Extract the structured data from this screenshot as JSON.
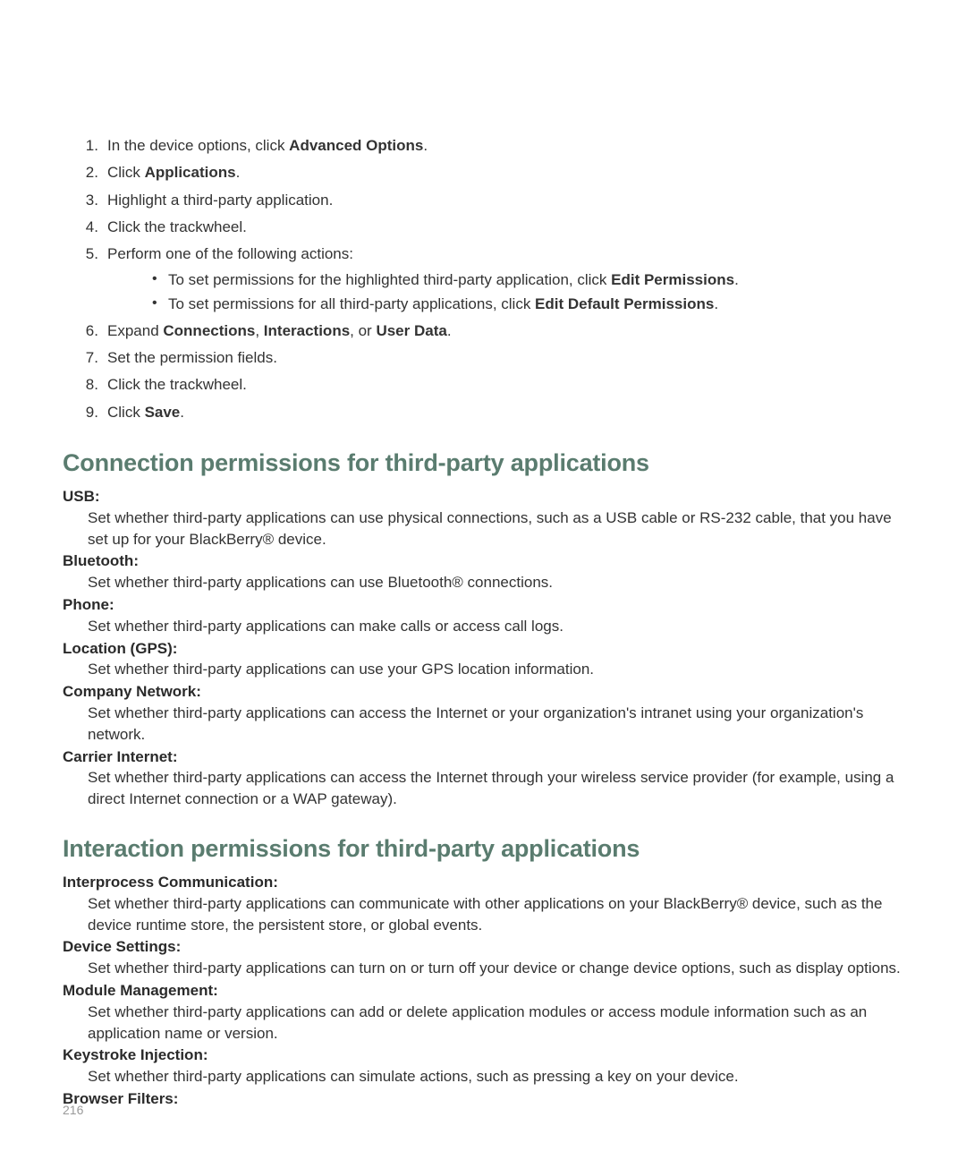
{
  "steps": [
    {
      "parts": [
        {
          "t": "In the device options, click "
        },
        {
          "t": "Advanced Options",
          "b": true
        },
        {
          "t": "."
        }
      ]
    },
    {
      "parts": [
        {
          "t": "Click "
        },
        {
          "t": "Applications",
          "b": true
        },
        {
          "t": "."
        }
      ]
    },
    {
      "parts": [
        {
          "t": "Highlight a third-party application."
        }
      ]
    },
    {
      "parts": [
        {
          "t": "Click the trackwheel."
        }
      ]
    },
    {
      "parts": [
        {
          "t": "Perform one of the following actions:"
        }
      ],
      "sub": [
        [
          {
            "t": "To set permissions for the highlighted third-party application, click "
          },
          {
            "t": "Edit Permissions",
            "b": true
          },
          {
            "t": "."
          }
        ],
        [
          {
            "t": "To set permissions for all third-party applications, click "
          },
          {
            "t": "Edit Default Permissions",
            "b": true
          },
          {
            "t": "."
          }
        ]
      ]
    },
    {
      "parts": [
        {
          "t": "Expand "
        },
        {
          "t": "Connections",
          "b": true
        },
        {
          "t": ", "
        },
        {
          "t": "Interactions",
          "b": true
        },
        {
          "t": ", or "
        },
        {
          "t": "User Data",
          "b": true
        },
        {
          "t": "."
        }
      ]
    },
    {
      "parts": [
        {
          "t": "Set the permission fields."
        }
      ]
    },
    {
      "parts": [
        {
          "t": "Click the trackwheel."
        }
      ]
    },
    {
      "parts": [
        {
          "t": "Click "
        },
        {
          "t": "Save",
          "b": true
        },
        {
          "t": "."
        }
      ]
    }
  ],
  "section1": {
    "title": "Connection permissions for third-party applications",
    "defs": [
      {
        "term": "USB:",
        "desc": "Set whether third-party applications can use physical connections, such as a USB cable or RS-232 cable, that you have set up for your BlackBerry® device."
      },
      {
        "term": "Bluetooth:",
        "desc": "Set whether third-party applications can use Bluetooth® connections."
      },
      {
        "term": "Phone:",
        "desc": "Set whether third-party applications can make calls or access call logs."
      },
      {
        "term": "Location (GPS):",
        "desc": "Set whether third-party applications can use your GPS location information."
      },
      {
        "term": "Company Network:",
        "desc": "Set whether third-party applications can access the Internet or your organization's intranet using your organization's network."
      },
      {
        "term": "Carrier Internet:",
        "desc": "Set whether third-party applications can access the Internet through your wireless service provider (for example, using a direct Internet connection or a WAP gateway)."
      }
    ]
  },
  "section2": {
    "title": "Interaction permissions for third-party applications",
    "defs": [
      {
        "term": "Interprocess Communication:",
        "desc": "Set whether third-party applications can communicate with other applications on your BlackBerry® device, such as the device runtime store, the persistent store, or global events."
      },
      {
        "term": "Device Settings:",
        "desc": "Set whether third-party applications can turn on or turn off your device or change device options, such as display options."
      },
      {
        "term": "Module Management:",
        "desc": "Set whether third-party applications can add or delete application modules or access module information such as an application name or version."
      },
      {
        "term": "Keystroke Injection:",
        "desc": "Set whether third-party applications can simulate actions, such as pressing a key on your device."
      },
      {
        "term": "Browser Filters:",
        "desc": ""
      }
    ]
  },
  "page_number": "216"
}
